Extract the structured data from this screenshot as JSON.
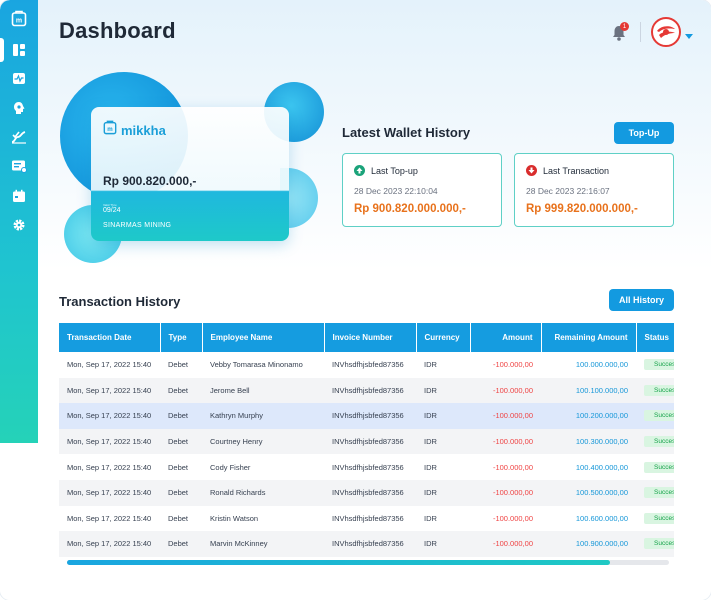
{
  "header": {
    "title": "Dashboard",
    "notification_count": "1"
  },
  "sidebar": {
    "items": [
      {
        "name": "home",
        "icon": "app-logo-icon"
      },
      {
        "name": "dashboard",
        "icon": "grid-icon"
      },
      {
        "name": "analytics",
        "icon": "pulse-icon"
      },
      {
        "name": "settings-head",
        "icon": "head-gear-icon"
      },
      {
        "name": "approval",
        "icon": "check-chart-icon"
      },
      {
        "name": "payments",
        "icon": "card-icon"
      },
      {
        "name": "calendar",
        "icon": "calendar-icon"
      },
      {
        "name": "settings",
        "icon": "gear-icon"
      }
    ]
  },
  "card": {
    "brand": "mikkha",
    "balance": "Rp 900.820.000,-",
    "valid_label": "Valid Thru",
    "valid_thru": "09/24",
    "holder": "SINARMAS MINING"
  },
  "wallet": {
    "title": "Latest Wallet History",
    "topup_label": "Top-Up",
    "last_topup": {
      "label": "Last Top-up",
      "time": "28 Dec 2023 22:10:04",
      "amount": "Rp 900.820.000.000,-"
    },
    "last_transaction": {
      "label": "Last Transaction",
      "time": "28 Dec 2023 22:16:07",
      "amount": "Rp 999.820.000.000,-"
    }
  },
  "transactions": {
    "title": "Transaction History",
    "all_history_label": "All History",
    "columns": [
      "Transaction Date",
      "Type",
      "Employee Name",
      "Invoice Number",
      "Currency",
      "Amount",
      "Remaining Amount",
      "Status"
    ],
    "rows": [
      [
        "Mon, Sep 17, 2022 15:40",
        "Debet",
        "Vebby Tomarasa Minonamo",
        "INVhsdfhjsbfed87356",
        "IDR",
        "-100.000,00",
        "100.000.000,00",
        "Success"
      ],
      [
        "Mon, Sep 17, 2022 15:40",
        "Debet",
        "Jerome Bell",
        "INVhsdfhjsbfed87356",
        "IDR",
        "-100.000,00",
        "100.100.000,00",
        "Success"
      ],
      [
        "Mon, Sep 17, 2022 15:40",
        "Debet",
        "Kathryn Murphy",
        "INVhsdfhjsbfed87356",
        "IDR",
        "-100.000,00",
        "100.200.000,00",
        "Success"
      ],
      [
        "Mon, Sep 17, 2022 15:40",
        "Debet",
        "Courtney Henry",
        "INVhsdfhjsbfed87356",
        "IDR",
        "-100.000,00",
        "100.300.000,00",
        "Success"
      ],
      [
        "Mon, Sep 17, 2022 15:40",
        "Debet",
        "Cody Fisher",
        "INVhsdfhjsbfed87356",
        "IDR",
        "-100.000,00",
        "100.400.000,00",
        "Success"
      ],
      [
        "Mon, Sep 17, 2022 15:40",
        "Debet",
        "Ronald Richards",
        "INVhsdfhjsbfed87356",
        "IDR",
        "-100.000,00",
        "100.500.000,00",
        "Success"
      ],
      [
        "Mon, Sep 17, 2022 15:40",
        "Debet",
        "Kristin Watson",
        "INVhsdfhjsbfed87356",
        "IDR",
        "-100.000,00",
        "100.600.000,00",
        "Success"
      ],
      [
        "Mon, Sep 17, 2022 15:40",
        "Debet",
        "Marvin McKinney",
        "INVhsdfhjsbfed87356",
        "IDR",
        "-100.000,00",
        "100.900.000,00",
        "Success"
      ]
    ],
    "highlighted_row": 2
  },
  "colors": {
    "accent": "#139ae0",
    "amount_negative": "#ef4444",
    "remaining": "#1697d8",
    "wallet_amount": "#e8721c",
    "success": "#16a34a"
  }
}
